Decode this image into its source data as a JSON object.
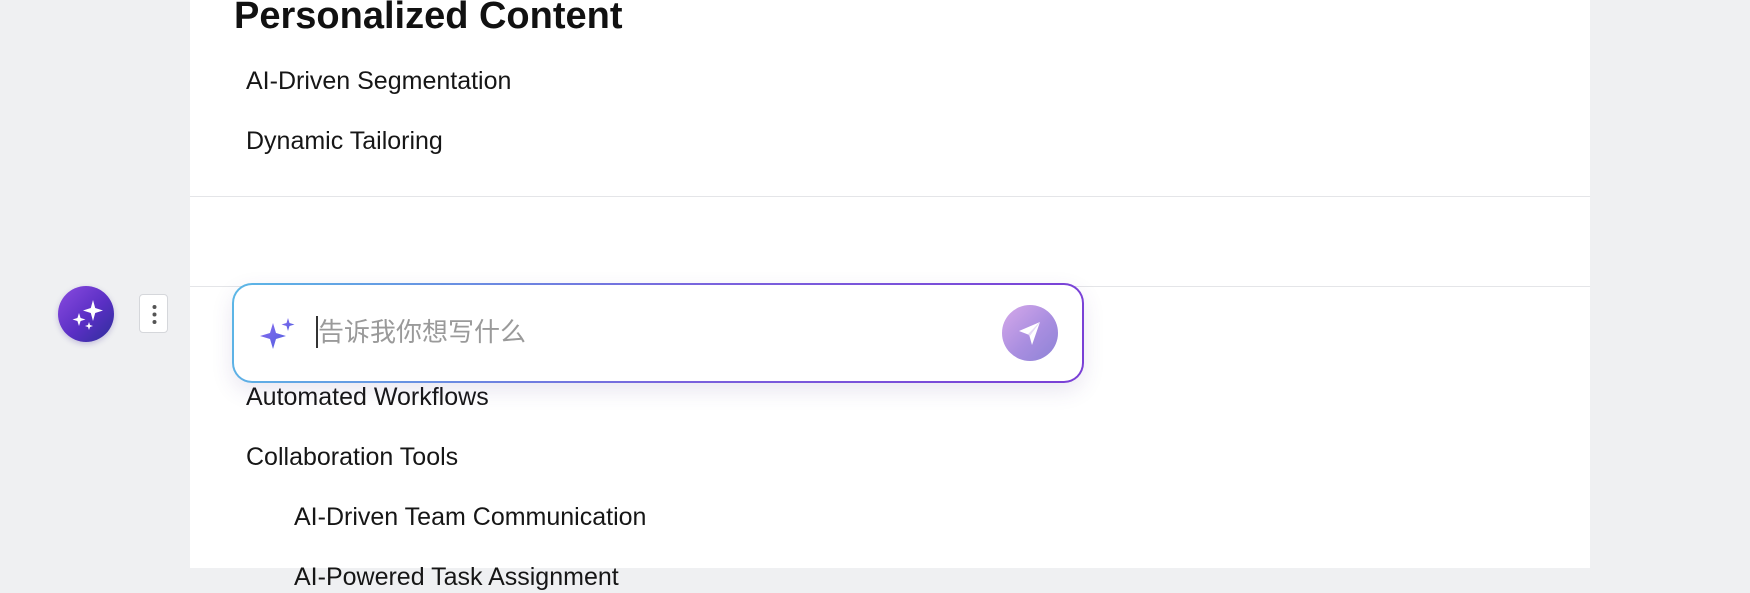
{
  "document": {
    "section_heading": "Personalized Content",
    "items": [
      "AI-Driven Segmentation",
      "Dynamic Tailoring",
      "Automated Workflows",
      "Collaboration Tools",
      "AI-Driven Team Communication",
      "AI-Powered Task Assignment"
    ]
  },
  "ai_prompt": {
    "placeholder": "告诉我你想写什么",
    "value": ""
  },
  "icons": {
    "avatar": "sparkles-icon",
    "handle": "vertical-dots-icon",
    "prompt": "sparkle-icon",
    "send": "paper-plane-icon"
  },
  "colors": {
    "accent_gradient_start": "#5bb7e6",
    "accent_gradient_end": "#7a3fd6",
    "avatar_purple": "#6a3bd0",
    "send_button": "#b49be2"
  }
}
